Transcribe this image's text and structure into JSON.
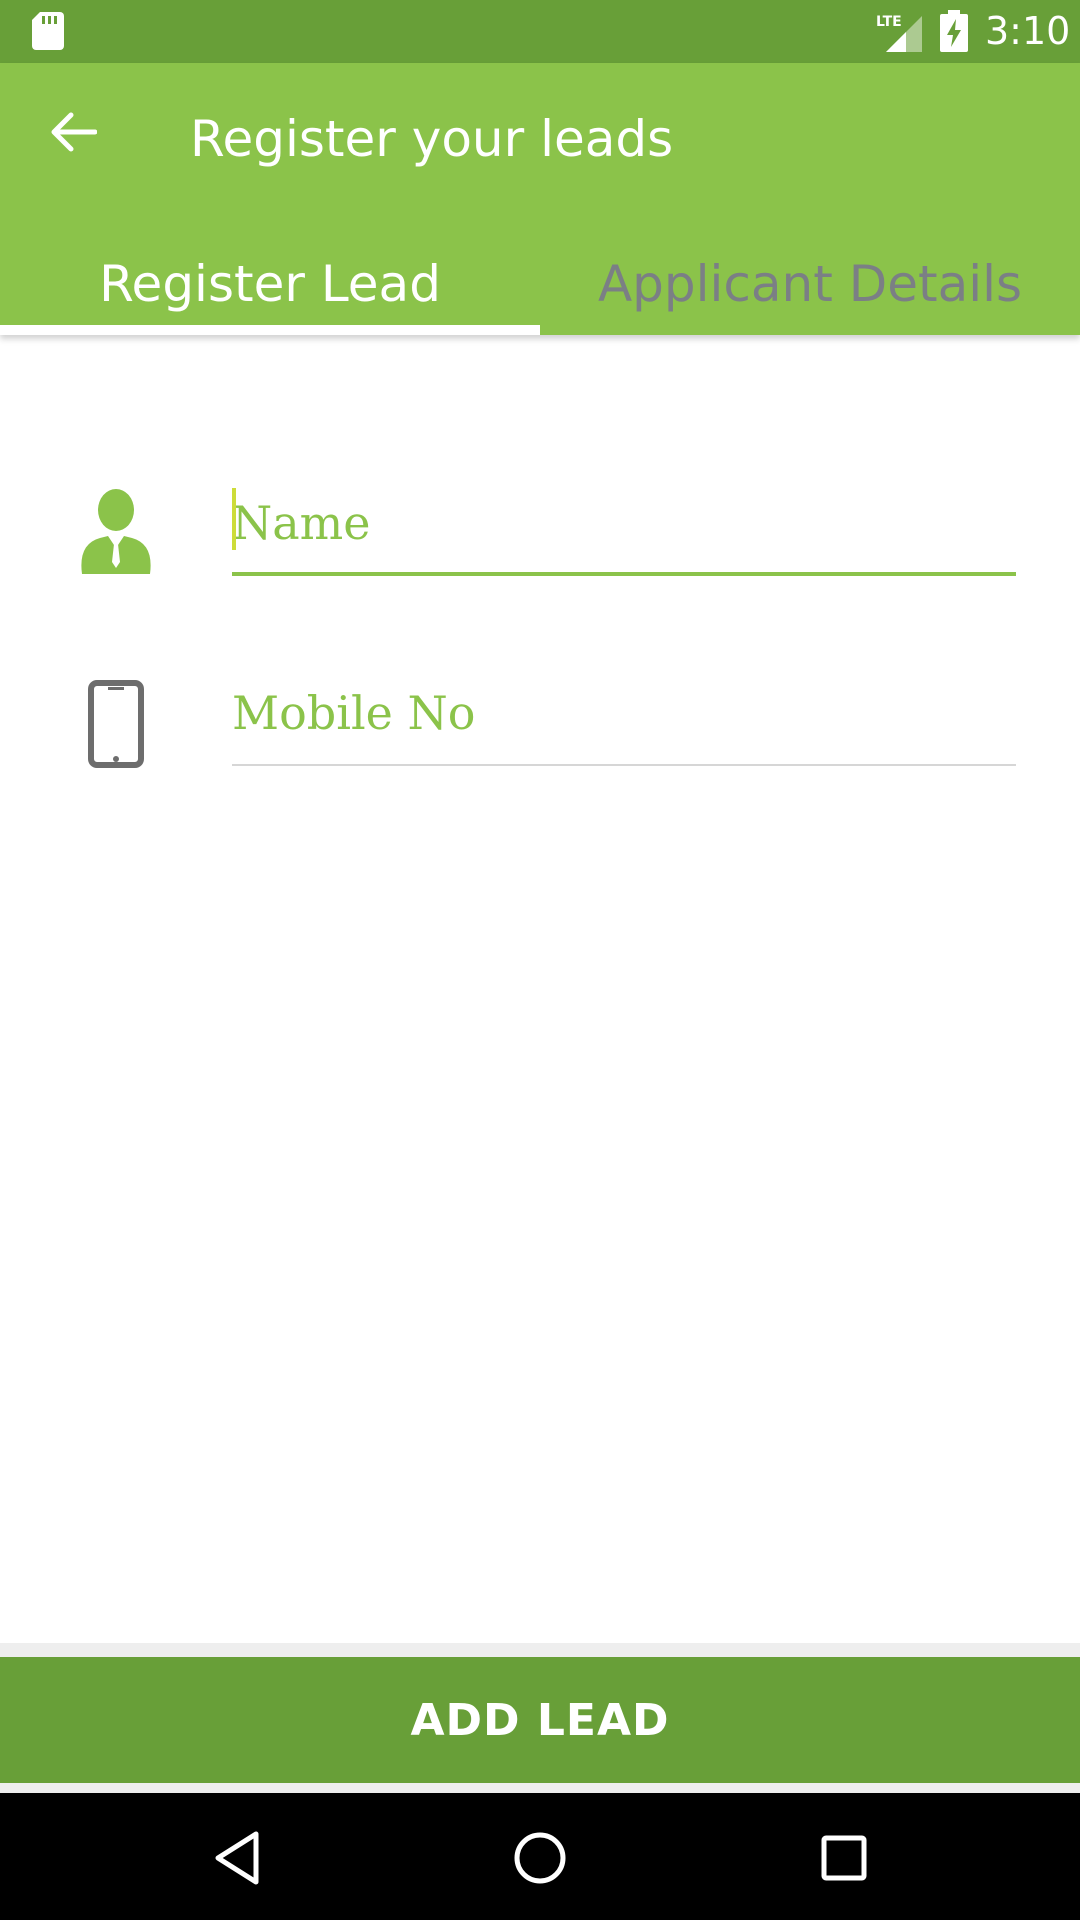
{
  "status_bar": {
    "time": "3:10",
    "network": "LTE"
  },
  "app_bar": {
    "title": "Register your leads"
  },
  "tabs": [
    {
      "label": "Register Lead",
      "active": true
    },
    {
      "label": "Applicant Details",
      "active": false
    }
  ],
  "form": {
    "name": {
      "placeholder": "Name",
      "value": "",
      "icon": "person-icon"
    },
    "mobile": {
      "placeholder": "Mobile No",
      "value": "",
      "icon": "phone-icon"
    }
  },
  "actions": {
    "add_lead_label": "ADD LEAD"
  },
  "colors": {
    "primary": "#8bc34a",
    "primary_dark": "#689f38",
    "accent": "#cddc39",
    "tab_inactive": "#7b7f85"
  }
}
